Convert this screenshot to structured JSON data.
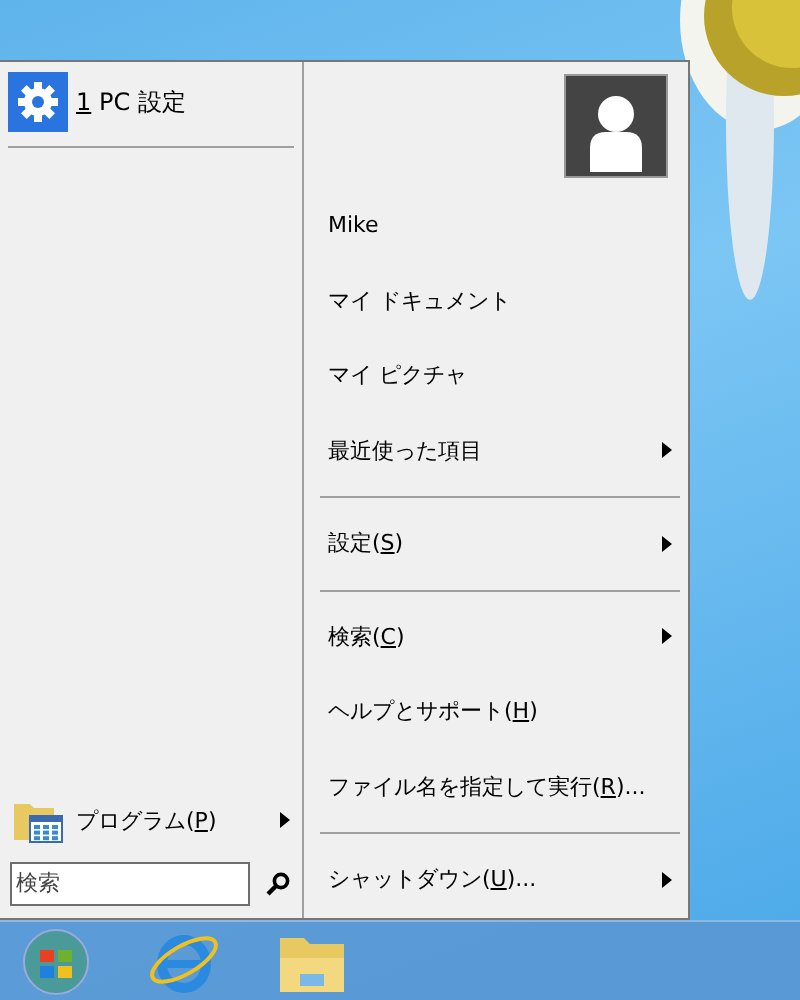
{
  "start_menu": {
    "pinned": [
      {
        "number": "1",
        "label": " PC 設定"
      }
    ],
    "programs": {
      "prefix": "プログラム(",
      "access_key": "P",
      "suffix": ")"
    },
    "search": {
      "placeholder": "検索"
    },
    "user": {
      "name": "Mike"
    },
    "right_items": [
      {
        "kind": "item",
        "prefix": "マイ ドキュメント",
        "submenu": false
      },
      {
        "kind": "item",
        "prefix": "マイ ピクチャ",
        "submenu": false
      },
      {
        "kind": "item",
        "prefix": "最近使った項目",
        "submenu": true
      },
      {
        "kind": "separator"
      },
      {
        "kind": "item",
        "prefix": "設定(",
        "access_key": "S",
        "suffix": ")",
        "submenu": true
      },
      {
        "kind": "separator"
      },
      {
        "kind": "item",
        "prefix": "検索(",
        "access_key": "C",
        "suffix": ")",
        "submenu": true
      },
      {
        "kind": "item",
        "prefix": "ヘルプとサポート(",
        "access_key": "H",
        "suffix": ")",
        "submenu": false
      },
      {
        "kind": "item",
        "prefix": "ファイル名を指定して実行(",
        "access_key": "R",
        "suffix": ")...",
        "submenu": false
      },
      {
        "kind": "separator"
      },
      {
        "kind": "item",
        "prefix": "シャットダウン(",
        "access_key": "U",
        "suffix": ")...",
        "submenu": true
      }
    ]
  }
}
